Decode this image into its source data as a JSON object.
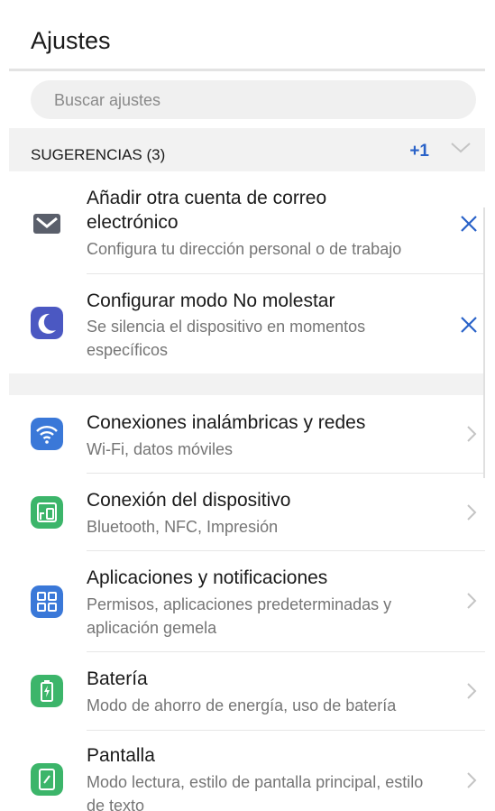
{
  "header": {
    "title": "Ajustes"
  },
  "search": {
    "placeholder": "Buscar ajustes"
  },
  "suggestions": {
    "header_label": "SUGERENCIAS (3)",
    "more_badge": "+1",
    "items": [
      {
        "title_line1": "Añadir otra cuenta de correo",
        "title_line2": "electrónico",
        "subtitle": "Configura tu dirección personal o de trabajo",
        "icon": "mail-icon"
      },
      {
        "title_line1": "Configurar modo No molestar",
        "subtitle_line1": "Se silencia el dispositivo en momentos",
        "subtitle_line2": "específicos",
        "icon": "moon-icon"
      }
    ]
  },
  "settings": {
    "items": [
      {
        "title": "Conexiones inalámbricas y redes",
        "subtitle": "Wi-Fi, datos móviles",
        "icon": "wifi-icon",
        "color": "#3a78d8"
      },
      {
        "title": "Conexión del dispositivo",
        "subtitle": "Bluetooth, NFC, Impresión",
        "icon": "device-connection-icon",
        "color": "#3cb56a"
      },
      {
        "title": "Aplicaciones y notificaciones",
        "subtitle_line1": "Permisos, aplicaciones predeterminadas y",
        "subtitle_line2": "aplicación gemela",
        "icon": "apps-icon",
        "color": "#3a78d8"
      },
      {
        "title": "Batería",
        "subtitle": "Modo de ahorro de energía, uso de batería",
        "icon": "battery-icon",
        "color": "#3cb56a"
      },
      {
        "title": "Pantalla",
        "subtitle_line1": "Modo lectura, estilo de pantalla principal, estilo",
        "subtitle_line2": "de texto",
        "icon": "display-icon",
        "color": "#3cb56a"
      }
    ]
  },
  "colors": {
    "accent": "#2962c8",
    "mail_icon": "#5a5f6b",
    "moon_icon": "#4b58c2",
    "blue_icon": "#3a78d8",
    "green_icon": "#3cb56a"
  }
}
